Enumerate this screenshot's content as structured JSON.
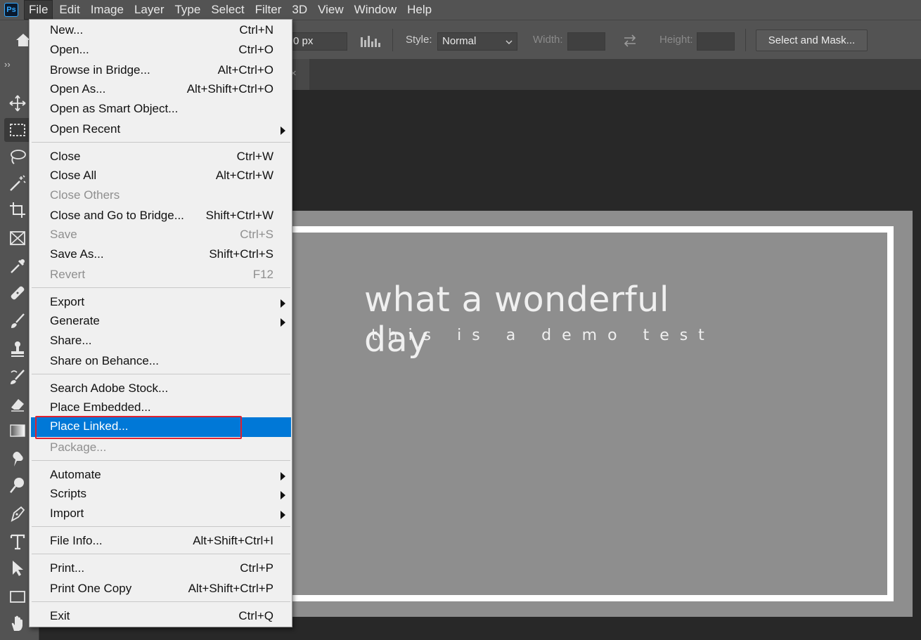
{
  "app": {
    "logo_text": "Ps"
  },
  "menubar": {
    "items": [
      "File",
      "Edit",
      "Image",
      "Layer",
      "Type",
      "Select",
      "Filter",
      "3D",
      "View",
      "Window",
      "Help"
    ],
    "active": "File"
  },
  "options": {
    "feather_value": "0 px",
    "style_label": "Style:",
    "style_value": "Normal",
    "width_label": "Width:",
    "height_label": "Height:",
    "select_mask_label": "Select and Mask..."
  },
  "toolbar": {
    "collapse": "››",
    "tools": [
      "move-tool",
      "rectangular-marquee-tool",
      "lasso-tool",
      "magic-wand-tool",
      "crop-tool",
      "frame-tool",
      "eyedropper-tool",
      "healing-brush-tool",
      "brush-tool",
      "clone-stamp-tool",
      "history-brush-tool",
      "eraser-tool",
      "gradient-tool",
      "smudge-tool",
      "dodge-tool",
      "pen-tool",
      "type-tool",
      "path-selection-tool",
      "rectangle-tool",
      "hand-tool"
    ],
    "selected": "rectangular-marquee-tool"
  },
  "tab": {
    "close": "×"
  },
  "canvas": {
    "title": "what a wonderful day",
    "subtitle": "this is a demo test"
  },
  "file_menu": {
    "items": [
      {
        "label": "New...",
        "shortcut": "Ctrl+N"
      },
      {
        "label": "Open...",
        "shortcut": "Ctrl+O"
      },
      {
        "label": "Browse in Bridge...",
        "shortcut": "Alt+Ctrl+O"
      },
      {
        "label": "Open As...",
        "shortcut": "Alt+Shift+Ctrl+O"
      },
      {
        "label": "Open as Smart Object...",
        "shortcut": ""
      },
      {
        "label": "Open Recent",
        "shortcut": "",
        "submenu": true
      },
      {
        "label": "Close",
        "shortcut": "Ctrl+W"
      },
      {
        "label": "Close All",
        "shortcut": "Alt+Ctrl+W"
      },
      {
        "label": "Close Others",
        "shortcut": "",
        "disabled": true
      },
      {
        "label": "Close and Go to Bridge...",
        "shortcut": "Shift+Ctrl+W"
      },
      {
        "label": "Save",
        "shortcut": "Ctrl+S",
        "disabled": true
      },
      {
        "label": "Save As...",
        "shortcut": "Shift+Ctrl+S"
      },
      {
        "label": "Revert",
        "shortcut": "F12",
        "disabled": true
      },
      {
        "label": "Export",
        "shortcut": "",
        "submenu": true
      },
      {
        "label": "Generate",
        "shortcut": "",
        "submenu": true
      },
      {
        "label": "Share...",
        "shortcut": ""
      },
      {
        "label": "Share on Behance...",
        "shortcut": ""
      },
      {
        "label": "Search Adobe Stock...",
        "shortcut": ""
      },
      {
        "label": "Place Embedded...",
        "shortcut": ""
      },
      {
        "label": "Place Linked...",
        "shortcut": "",
        "highlighted": true
      },
      {
        "label": "Package...",
        "shortcut": "",
        "disabled": true
      },
      {
        "label": "Automate",
        "shortcut": "",
        "submenu": true
      },
      {
        "label": "Scripts",
        "shortcut": "",
        "submenu": true
      },
      {
        "label": "Import",
        "shortcut": "",
        "submenu": true
      },
      {
        "label": "File Info...",
        "shortcut": "Alt+Shift+Ctrl+I"
      },
      {
        "label": "Print...",
        "shortcut": "Ctrl+P"
      },
      {
        "label": "Print One Copy",
        "shortcut": "Alt+Shift+Ctrl+P"
      },
      {
        "label": "Exit",
        "shortcut": "Ctrl+Q"
      }
    ]
  },
  "colors": {
    "highlight": "#0078d7",
    "annotation": "#e0212f",
    "ps_blue": "#31a8ff"
  }
}
